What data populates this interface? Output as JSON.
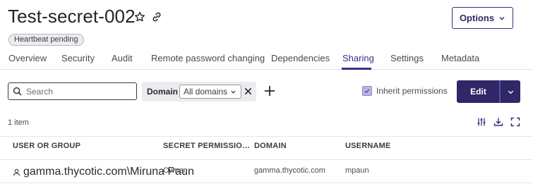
{
  "header": {
    "title": "Test-secret-002",
    "options_label": "Options",
    "status_badge": "Heartbeat pending"
  },
  "tabs": [
    {
      "label": "Overview",
      "active": false
    },
    {
      "label": "Security",
      "active": false
    },
    {
      "label": "Audit",
      "active": false
    },
    {
      "label": "Remote password changing",
      "active": false
    },
    {
      "label": "Dependencies",
      "active": false
    },
    {
      "label": "Sharing",
      "active": true
    },
    {
      "label": "Settings",
      "active": false
    },
    {
      "label": "Metadata",
      "active": false
    }
  ],
  "toolbar": {
    "search_placeholder": "Search",
    "search_value": "",
    "domain_label": "Domain",
    "domain_value": "All domains",
    "inherit_label": "Inherit permissions",
    "inherit_checked": true,
    "edit_label": "Edit"
  },
  "list": {
    "count_label": "1 item",
    "columns": [
      "USER OR GROUP",
      "SECRET PERMISSIO…",
      "DOMAIN",
      "USERNAME"
    ],
    "rows": [
      {
        "user_or_group": "gamma.thycotic.com\\Miruna Paun",
        "permission": "Owner",
        "domain": "gamma.thycotic.com",
        "username": "mpaun"
      }
    ]
  },
  "colors": {
    "accent": "#2f2768",
    "active_tab": "#3b2f8f"
  }
}
